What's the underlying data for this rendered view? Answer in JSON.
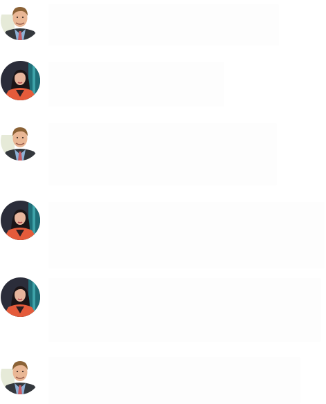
{
  "conversation": {
    "messages": [
      {
        "sender": "man",
        "avatar_icon": "man-avatar-icon",
        "text": ""
      },
      {
        "sender": "woman",
        "avatar_icon": "woman-avatar-icon",
        "text": ""
      },
      {
        "sender": "man",
        "avatar_icon": "man-avatar-icon",
        "text": ""
      },
      {
        "sender": "woman",
        "avatar_icon": "woman-avatar-icon",
        "text": ""
      },
      {
        "sender": "woman",
        "avatar_icon": "woman-avatar-icon",
        "text": ""
      },
      {
        "sender": "man",
        "avatar_icon": "man-avatar-icon",
        "text": ""
      }
    ]
  },
  "colors": {
    "page_background": "#ffffff",
    "bubble_background": "#fdfdfd"
  }
}
